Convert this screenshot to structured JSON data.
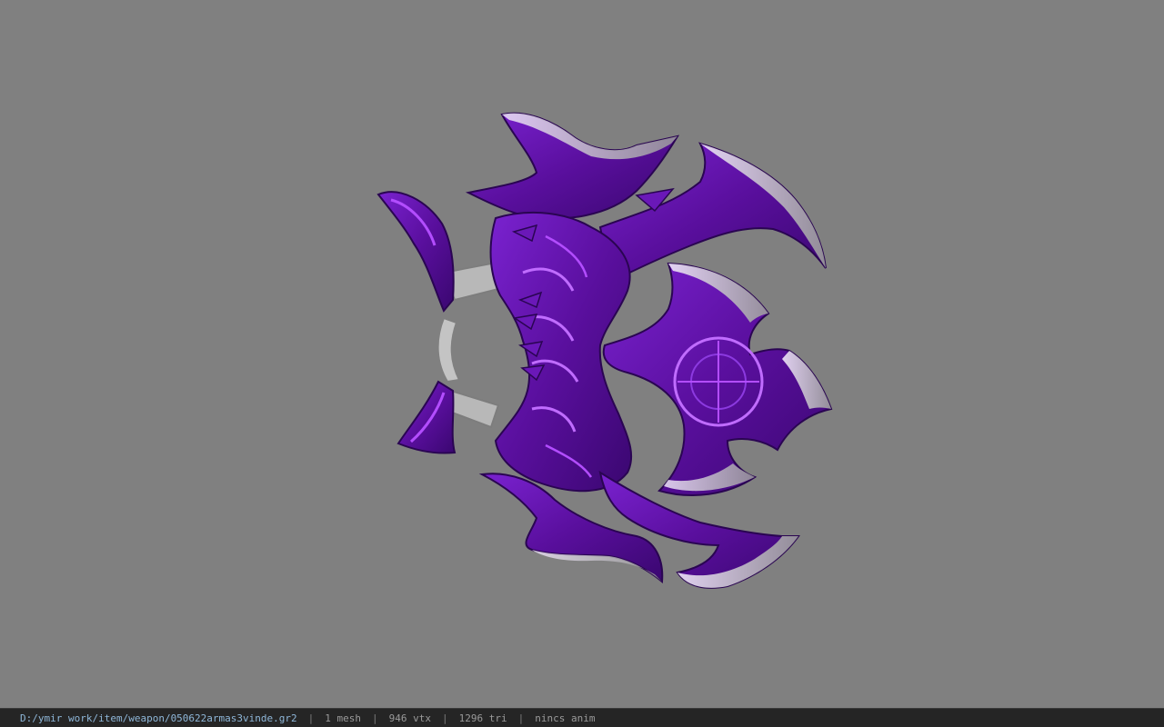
{
  "viewer": {
    "background_color": "#808080",
    "model_colors": {
      "base": "#5a0f9e",
      "dark": "#2a0552",
      "highlight": "#b34dff",
      "edge": "#e8dcf4",
      "steel": "#bdbdbd"
    },
    "model_name": "050622armas3vinde"
  },
  "status": {
    "file_path": "D:/ymir work/item/weapon/050622armas3vinde.gr2",
    "separator": "|",
    "mesh_count": "1 mesh",
    "vertex_count": "946 vtx",
    "triangle_count": "1296 tri",
    "animation": "nincs anim"
  }
}
